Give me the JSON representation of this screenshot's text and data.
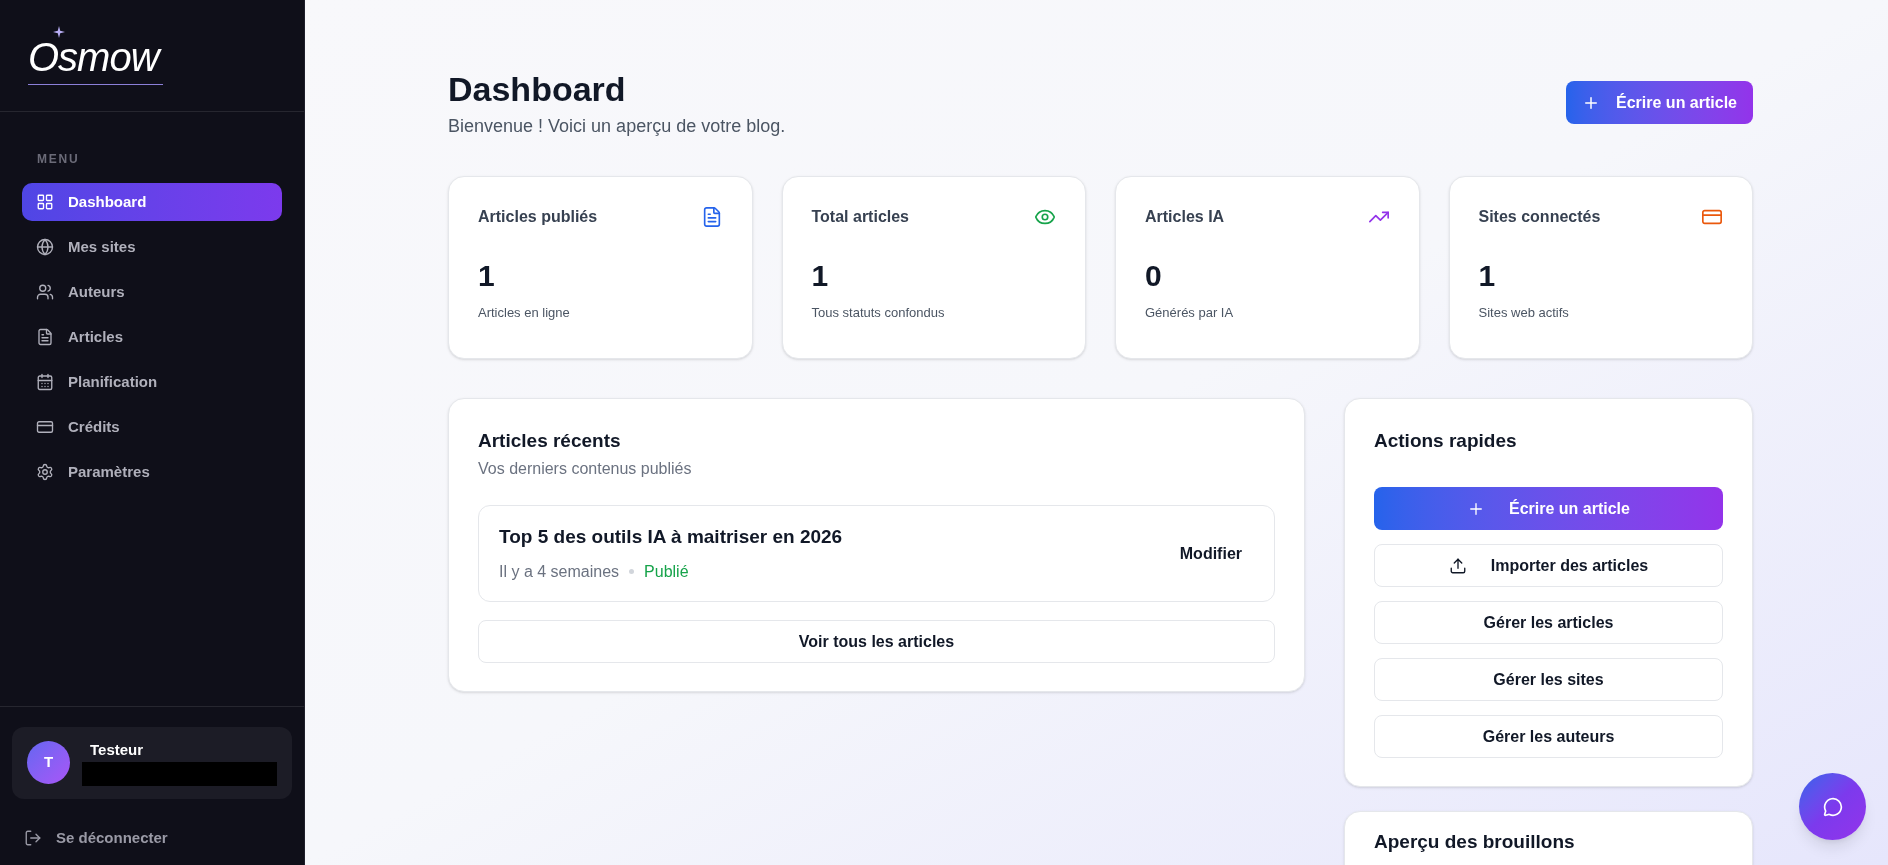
{
  "sidebar": {
    "logo": "Osmow",
    "section_label": "MENU",
    "items": [
      {
        "label": "Dashboard",
        "selected": true
      },
      {
        "label": "Mes sites",
        "selected": false
      },
      {
        "label": "Auteurs",
        "selected": false
      },
      {
        "label": "Articles",
        "selected": false
      },
      {
        "label": "Planification",
        "selected": false
      },
      {
        "label": "Crédits",
        "selected": false
      },
      {
        "label": "Paramètres",
        "selected": false
      }
    ],
    "user": {
      "initial": "T",
      "name": "Testeur"
    },
    "logout": "Se déconnecter"
  },
  "header": {
    "title": "Dashboard",
    "subtitle": "Bienvenue ! Voici un aperçu de votre blog.",
    "action": "Écrire un article"
  },
  "stats": [
    {
      "title": "Articles publiés",
      "value": "1",
      "caption": "Articles en ligne",
      "color": "#2563eb"
    },
    {
      "title": "Total articles",
      "value": "1",
      "caption": "Tous statuts confondus",
      "color": "#16a34a"
    },
    {
      "title": "Articles IA",
      "value": "0",
      "caption": "Générés par IA",
      "color": "#9333ea"
    },
    {
      "title": "Sites connectés",
      "value": "1",
      "caption": "Sites web actifs",
      "color": "#ea580c"
    }
  ],
  "recent": {
    "title": "Articles récents",
    "subtitle": "Vos derniers contenus publiés",
    "articles": [
      {
        "title": "Top 5 des outils IA à maitriser en 2026",
        "age": "Il y a 4 semaines",
        "status": "Publié",
        "action": "Modifier"
      }
    ],
    "view_all": "Voir tous les articles"
  },
  "quick_actions": {
    "title": "Actions rapides",
    "buttons": [
      {
        "kind": "primary",
        "label": "Écrire un article"
      },
      {
        "kind": "upload",
        "label": "Importer des articles"
      },
      {
        "kind": "outline",
        "label": "Gérer les articles"
      },
      {
        "kind": "outline",
        "label": "Gérer les sites"
      },
      {
        "kind": "outline",
        "label": "Gérer les auteurs"
      }
    ]
  },
  "drafts": {
    "title": "Aperçu des brouillons"
  }
}
